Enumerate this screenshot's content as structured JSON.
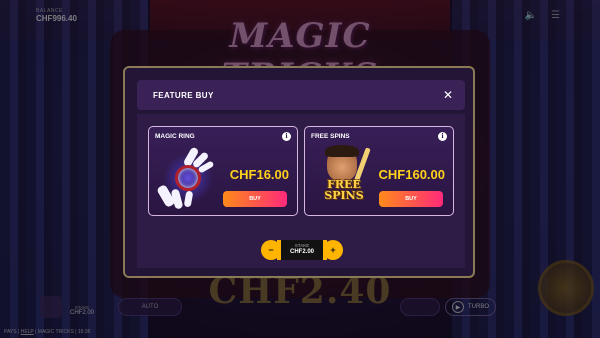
{
  "balance": {
    "label": "BALANCE",
    "value": "CHF996.40"
  },
  "top_icons": {
    "sound": "speaker-icon",
    "menu": "menu-icon"
  },
  "game": {
    "logo": "MAGIC TRICKS",
    "bet_display": "CHF2.40"
  },
  "bottom": {
    "stake_label": "STAKE",
    "stake_value": "CHF2.00",
    "auto_label": "AUTO",
    "turbo_label": "TURBO",
    "footer": {
      "pays": "PAYS",
      "help": "HELP",
      "game_name": "MAGIC TRICKS",
      "time": "16:36",
      "separator": "|"
    }
  },
  "modal": {
    "title": "FEATURE BUY",
    "close_icon": "close-icon",
    "cards": [
      {
        "name": "MAGIC RING",
        "price": "CHF16.00",
        "buy_label": "BUY",
        "icon": "magic-ring-icon"
      },
      {
        "name": "FREE SPINS",
        "price": "CHF160.00",
        "buy_label": "BUY",
        "art_text_1": "FREE",
        "art_text_2": "SPINS",
        "icon": "free-spins-icon"
      }
    ],
    "stake": {
      "label": "STAKE",
      "value": "CHF2.00",
      "minus": "−",
      "plus": "+"
    }
  },
  "colors": {
    "accent_yellow": "#ffd21a",
    "buy_gradient_start": "#ff8a1a",
    "buy_gradient_end": "#ff2a7a",
    "modal_bg": "#231536",
    "stepper": "#ffb400"
  }
}
